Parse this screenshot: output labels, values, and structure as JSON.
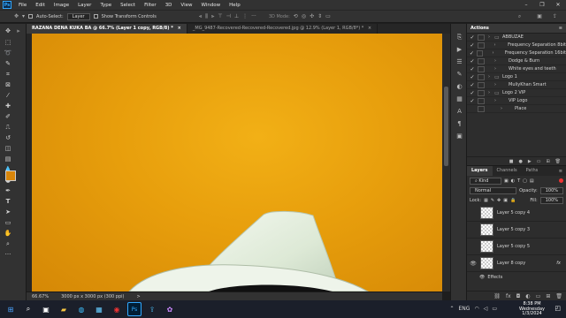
{
  "app": {
    "logo_text": "Ps"
  },
  "menu": [
    "File",
    "Edit",
    "Image",
    "Layer",
    "Type",
    "Select",
    "Filter",
    "3D",
    "View",
    "Window",
    "Help"
  ],
  "options": {
    "auto_select_label": "Auto-Select:",
    "auto_select_value": "Layer",
    "show_transform_label": "Show Transform Controls",
    "mode_3d_label": "3D Mode:"
  },
  "tabs": [
    {
      "label": "RAZANA DENA KUKA BA  @ 66.7% (Layer 1 copy, RGB/8) *",
      "close": "×"
    },
    {
      "label": "_MG_9487-Recovered-Recovered-Recovered.jpg @ 12.9% (Layer 1, RGB/8*) *",
      "close": "×"
    }
  ],
  "status": {
    "zoom": "66.67%",
    "doc_size": "3000 px x 3000 px (300 ppi)",
    "arrow": ">"
  },
  "actions_panel": {
    "title": "Actions",
    "items": [
      {
        "label": "ABBUZAE",
        "level": 0,
        "checked": true
      },
      {
        "label": "Frequency Separation 8bit",
        "level": 1,
        "checked": true
      },
      {
        "label": "Frequency Separation 16bit",
        "level": 1,
        "checked": true
      },
      {
        "label": "Dodge & Burn",
        "level": 1,
        "checked": true
      },
      {
        "label": "White eyes and teeth",
        "level": 1,
        "checked": true
      },
      {
        "label": "Logo 1",
        "level": 0,
        "checked": true
      },
      {
        "label": "MuliyKhan Smart",
        "level": 1,
        "checked": true
      },
      {
        "label": "Logo 2 VIP",
        "level": 0,
        "checked": true
      },
      {
        "label": "VIP Logo",
        "level": 1,
        "checked": true
      },
      {
        "label": "Place",
        "level": 2,
        "checked": false
      }
    ]
  },
  "layers_panel": {
    "tabs": [
      "Layers",
      "Channels",
      "Paths"
    ],
    "filter": "Kind",
    "blend_mode": "Normal",
    "opacity_label": "Opacity:",
    "opacity": "100%",
    "lock_label": "Lock:",
    "fill_label": "Fill:",
    "fill": "100%",
    "layers": [
      {
        "name": "Layer 5 copy 4",
        "visible": false
      },
      {
        "name": "Layer 5 copy 3",
        "visible": false
      },
      {
        "name": "Layer 5 copy 5",
        "visible": false
      },
      {
        "name": "Layer 8 copy",
        "visible": true,
        "fx": "fx"
      }
    ],
    "effects_label": "Effects"
  },
  "taskbar": {
    "time": "8:38 PM",
    "day": "Wednesday",
    "date": "1/3/2024",
    "lang": "ENG"
  },
  "colors": {
    "canvas": "#e9a10e",
    "foreground": "#d9860a",
    "background": "#111111",
    "accent": "#31a8ff"
  }
}
